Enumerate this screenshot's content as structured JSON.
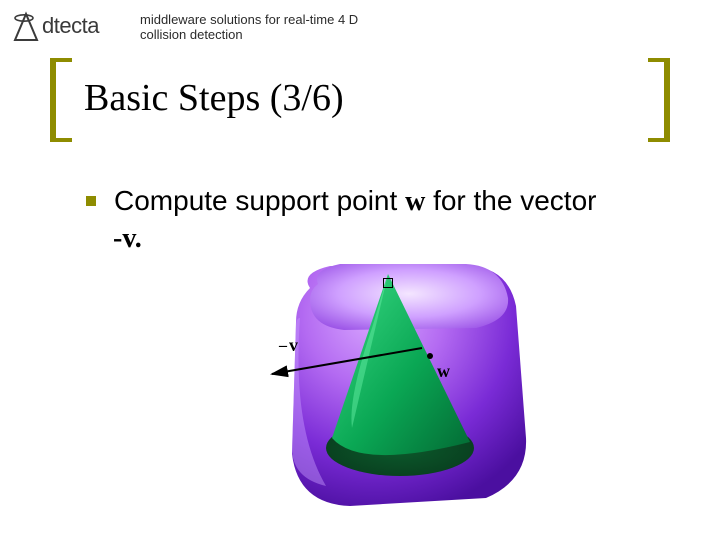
{
  "brand": {
    "name": "dtecta",
    "tagline_line1": "middleware solutions for real-time 4 D",
    "tagline_line2": "collision detection"
  },
  "slide": {
    "title": "Basic Steps (3/6)",
    "bullet_prefix": "Compute support point ",
    "bullet_w": "w",
    "bullet_suffix": " for the vector",
    "neg_v_line": "-v."
  },
  "figure": {
    "minus_sign": "–",
    "v_label": "v",
    "w_label": "w"
  }
}
